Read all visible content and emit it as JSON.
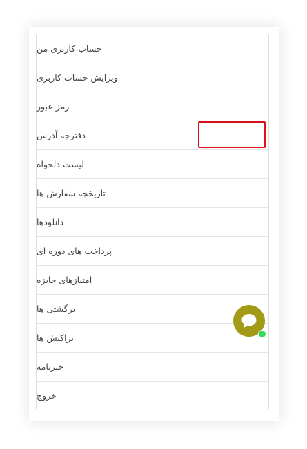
{
  "menu": {
    "items": [
      {
        "label": "حساب کاربری من"
      },
      {
        "label": "ویرایش حساب کاربری"
      },
      {
        "label": "رمز عبور"
      },
      {
        "label": "دفترچه آدرس"
      },
      {
        "label": "لیست دلخواه"
      },
      {
        "label": "تاریخچه سفارش ها"
      },
      {
        "label": "دانلودها"
      },
      {
        "label": "پرداخت های دوره ای"
      },
      {
        "label": "امتیازهای جایزه"
      },
      {
        "label": "برگشتی ها"
      },
      {
        "label": "تراکنش ها"
      },
      {
        "label": "خبرنامه"
      },
      {
        "label": "خروج"
      }
    ],
    "selected": "دفترچه آدرس"
  },
  "chat_widget": {
    "icon": "chat-bubble-icon",
    "color": "#a39a18",
    "status_color": "#33dd55"
  },
  "highlight_color": "#d8121b"
}
